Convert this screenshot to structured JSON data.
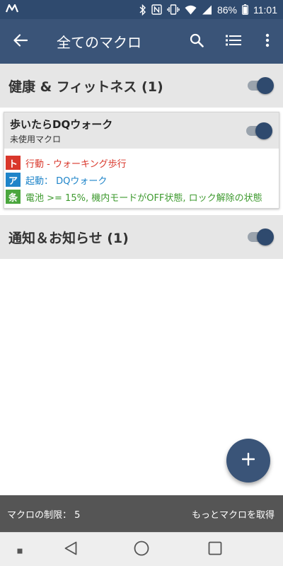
{
  "status_bar": {
    "app_icon": "m-logo-icon",
    "battery": "86%",
    "time": "11:01",
    "icons": [
      "bluetooth-icon",
      "nfc-icon",
      "vibrate-icon",
      "wifi-icon",
      "signal-icon",
      "battery-icon"
    ]
  },
  "app_bar": {
    "title": "全てのマクロ",
    "icons": [
      "back-arrow-icon",
      "search-icon",
      "list-icon",
      "more-vert-icon"
    ]
  },
  "categories": [
    {
      "title": "健康 & フィットネス (1)",
      "enabled": true,
      "macros": [
        {
          "name": "歩いたらDQウォーク",
          "subtitle": "未使用マクロ",
          "enabled": true,
          "rows": [
            {
              "badge": "ト",
              "text": "行動 - ウォーキング歩行",
              "color": "#d9372b"
            },
            {
              "badge": "ア",
              "text": "起動： DQウォーク",
              "color": "#1e84c9"
            },
            {
              "badge": "条",
              "text": "電池 >= 15%, 機内モードがOFF状態, ロック解除の状態",
              "color": "#3e9a2f"
            }
          ]
        }
      ]
    },
    {
      "title": "通知＆お知らせ (1)",
      "enabled": true,
      "macros": []
    }
  ],
  "fab": {
    "icon": "plus-icon"
  },
  "limit_bar": {
    "limit_text": "マクロの制限： 5",
    "more_text": "もっとマクロを取得"
  },
  "nav_bar": {
    "icons": [
      "recents-dot-icon",
      "back-triangle-icon",
      "home-circle-icon",
      "overview-square-icon"
    ]
  },
  "colors": {
    "primary": "#3a5478",
    "status_bar": "#2f4a6e",
    "trigger": "#d9372b",
    "action": "#1e84c9",
    "constraint": "#4aa63d"
  }
}
